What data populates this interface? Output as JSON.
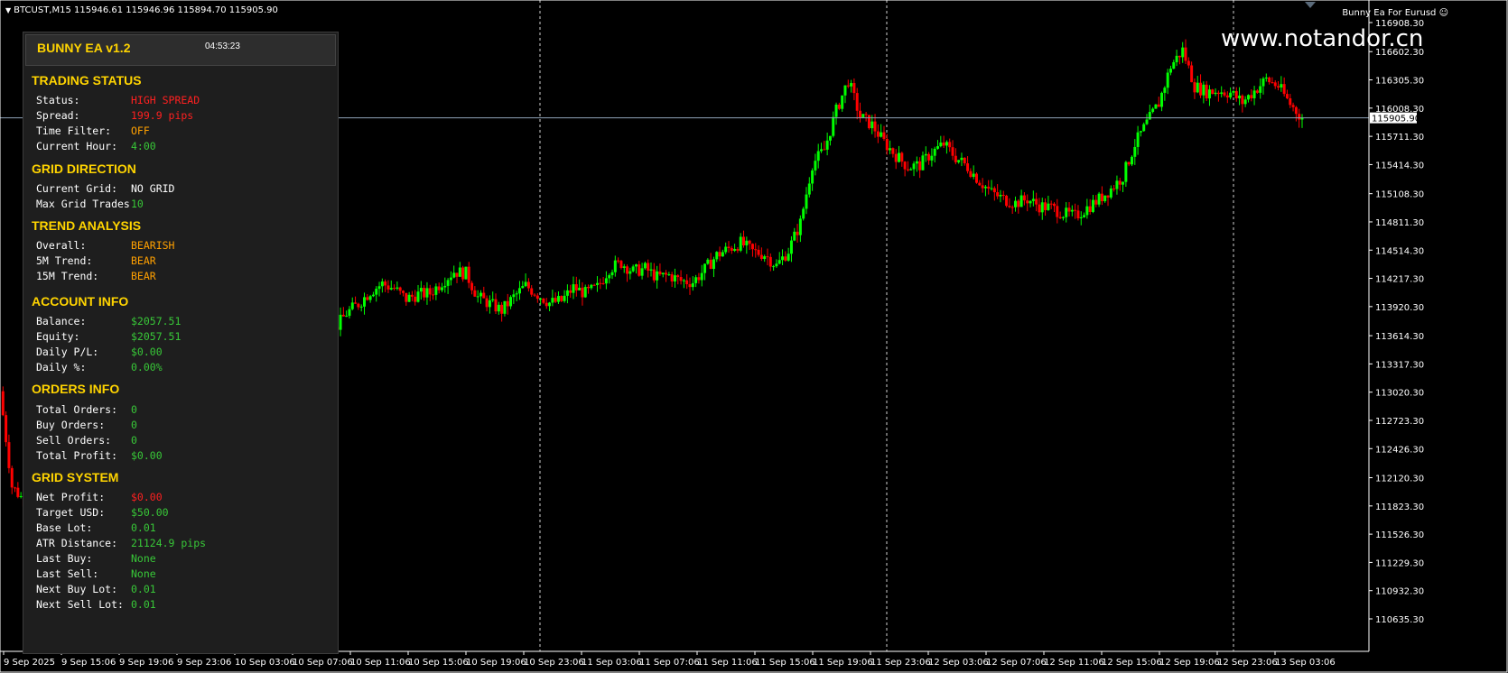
{
  "header": {
    "symbol_line": "BTCUST,M15  115946.61 115946.96 115894.70 115905.90",
    "ea_label": "Bunny Ea For Eurusd",
    "watermark": "www.notandor.cn"
  },
  "colors": {
    "background": "#000000",
    "bull_candle": "#00ff00",
    "bear_candle": "#ff0000",
    "price_line": "#8fa3b8",
    "panel_title": "#ffd400",
    "value_red": "#ff2020",
    "value_orange": "#ffa000",
    "value_green": "#38c838"
  },
  "price_axis": {
    "labels": [
      "116908.30",
      "116602.30",
      "116305.30",
      "116008.30",
      "115711.30",
      "115414.30",
      "115108.30",
      "114811.30",
      "114514.30",
      "114217.30",
      "113920.30",
      "113614.30",
      "113317.30",
      "113020.30",
      "112723.30",
      "112426.30",
      "112120.30",
      "111823.30",
      "111526.30",
      "111229.30",
      "110932.30",
      "110635.30"
    ],
    "current_price": "115905.90"
  },
  "time_axis": {
    "labels": [
      "9 Sep 2025",
      "9 Sep 15:06",
      "9 Sep 19:06",
      "9 Sep 23:06",
      "10 Sep 03:06",
      "10 Sep 07:06",
      "10 Sep 11:06",
      "10 Sep 15:06",
      "10 Sep 19:06",
      "10 Sep 23:06",
      "11 Sep 03:06",
      "11 Sep 07:06",
      "11 Sep 11:06",
      "11 Sep 15:06",
      "11 Sep 19:06",
      "11 Sep 23:06",
      "12 Sep 03:06",
      "12 Sep 07:06",
      "12 Sep 11:06",
      "12 Sep 15:06",
      "12 Sep 19:06",
      "12 Sep 23:06",
      "13 Sep 03:06"
    ]
  },
  "chart_data": {
    "type": "line",
    "series": [
      {
        "values": [
          113030,
          112030,
          111880,
          112040,
          112260,
          112050,
          112150,
          112120,
          112260,
          112230,
          112580,
          113450,
          113900,
          114150,
          114050,
          113800,
          113720,
          113430,
          113450,
          113660,
          113750,
          113860,
          113790,
          113750,
          113850,
          113910,
          113790,
          113700,
          113680,
          113850,
          113950,
          114080,
          114160,
          114110,
          114000,
          114050,
          114060,
          114180,
          114290,
          114270,
          114020,
          113950,
          113880,
          114020,
          114140,
          114050,
          113960,
          113980,
          114120,
          114060,
          114120,
          114320,
          114380,
          114290,
          114320,
          114230,
          114250,
          114190,
          114180,
          114310,
          114460,
          114530,
          114590,
          114500,
          114470,
          114350,
          114510,
          114800,
          115420,
          115570,
          115980,
          116300,
          115920,
          115830,
          115650,
          115510,
          115390,
          115410,
          115540,
          115630,
          115490,
          115390,
          115240,
          115120,
          115050,
          115010,
          115050,
          114980,
          114960,
          114900,
          114870,
          114960,
          115050,
          115160,
          115290,
          115630,
          115850,
          116060,
          116450,
          116620,
          116240,
          116180,
          116190,
          116170,
          116070,
          116190,
          116310,
          116240,
          116050,
          115905.9
        ]
      }
    ]
  },
  "panel": {
    "title": "BUNNY EA v1.2",
    "clock": "04:53:23",
    "sections": [
      {
        "heading": "TRADING STATUS",
        "rows": [
          {
            "label": "Status:",
            "value": "HIGH SPREAD",
            "tone": "red"
          },
          {
            "label": "Spread:",
            "value": "199.9 pips",
            "tone": "red"
          },
          {
            "label": "Time Filter:",
            "value": "OFF",
            "tone": "orange"
          },
          {
            "label": "Current Hour:",
            "value": "4:00",
            "tone": "green"
          }
        ]
      },
      {
        "heading": "GRID DIRECTION",
        "rows": [
          {
            "label": "Current Grid:",
            "value": "NO GRID",
            "tone": "white"
          },
          {
            "label": "Max Grid Trades",
            "value": "10",
            "tone": "green"
          }
        ]
      },
      {
        "heading": "TREND ANALYSIS",
        "rows": [
          {
            "label": "Overall:",
            "value": "BEARISH",
            "tone": "orange"
          },
          {
            "label": "5M Trend:",
            "value": "BEAR",
            "tone": "orange"
          },
          {
            "label": "15M Trend:",
            "value": "BEAR",
            "tone": "orange"
          }
        ]
      },
      {
        "heading": "ACCOUNT INFO",
        "rows": [
          {
            "label": "Balance:",
            "value": "$2057.51",
            "tone": "green"
          },
          {
            "label": "Equity:",
            "value": "$2057.51",
            "tone": "green"
          },
          {
            "label": "Daily P/L:",
            "value": "$0.00",
            "tone": "green"
          },
          {
            "label": "Daily %:",
            "value": "0.00%",
            "tone": "green"
          }
        ]
      },
      {
        "heading": "ORDERS INFO",
        "rows": [
          {
            "label": "Total Orders:",
            "value": "0",
            "tone": "green"
          },
          {
            "label": "Buy Orders:",
            "value": "0",
            "tone": "green"
          },
          {
            "label": "Sell Orders:",
            "value": "0",
            "tone": "green"
          },
          {
            "label": "Total Profit:",
            "value": "$0.00",
            "tone": "green"
          }
        ]
      },
      {
        "heading": "GRID SYSTEM",
        "rows": [
          {
            "label": "Net Profit:",
            "value": "$0.00",
            "tone": "red"
          },
          {
            "label": "Target USD:",
            "value": "$50.00",
            "tone": "green"
          },
          {
            "label": "Base Lot:",
            "value": "0.01",
            "tone": "green"
          },
          {
            "label": "ATR Distance:",
            "value": "21124.9 pips",
            "tone": "green"
          },
          {
            "label": "Last Buy:",
            "value": "None",
            "tone": "green"
          },
          {
            "label": "Last Sell:",
            "value": "None",
            "tone": "green"
          },
          {
            "label": "Next Buy Lot:",
            "value": "0.01",
            "tone": "green"
          },
          {
            "label": "Next Sell Lot:",
            "value": "0.01",
            "tone": "green"
          }
        ]
      }
    ]
  }
}
